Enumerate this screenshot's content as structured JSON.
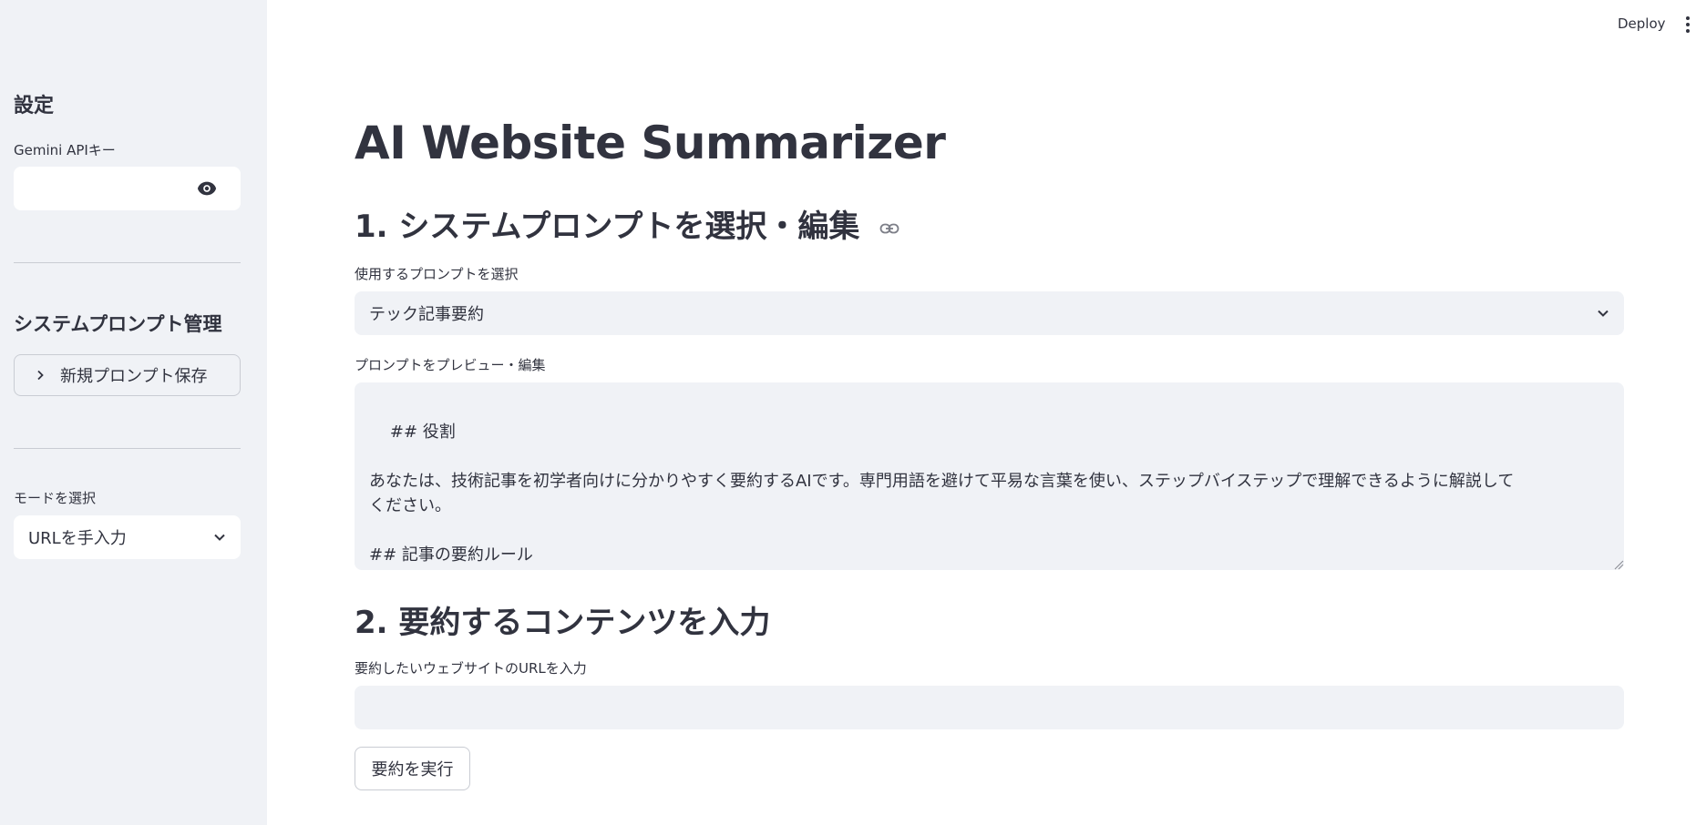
{
  "header": {
    "deploy_label": "Deploy",
    "menu_icon": "kebab-menu-icon"
  },
  "sidebar": {
    "title": "設定",
    "api_key_label": "Gemini APIキー",
    "api_key_value": "",
    "api_key_icon": "eye-icon",
    "prompt_mgmt_title": "システムプロンプト管理",
    "expander_label": "新規プロンプト保存",
    "mode_label": "モードを選択",
    "mode_value": "URLを手入力"
  },
  "main": {
    "title": "AI Website Summarizer",
    "section1_title": "1. システムプロンプトを選択・編集",
    "prompt_select_label": "使用するプロンプトを選択",
    "prompt_select_value": "テック記事要約",
    "prompt_edit_label": "プロンプトをプレビュー・編集",
    "prompt_text": "## 役割\n\nあなたは、技術記事を初学者向けに分かりやすく要約するAIです。専門用語を避けて平易な言葉を使い、ステップバイステップで理解できるように解説して\nください。\n\n## 記事の要約ルール",
    "section2_title": "2. 要約するコンテンツを入力",
    "url_label": "要約したいウェブサイトのURLを入力",
    "url_value": "",
    "run_button": "要約を実行"
  },
  "colors": {
    "sidebar_bg": "#f0f2f6",
    "input_bg": "#f0f2f6",
    "text": "#31333f",
    "border": "#c9ccd3"
  }
}
